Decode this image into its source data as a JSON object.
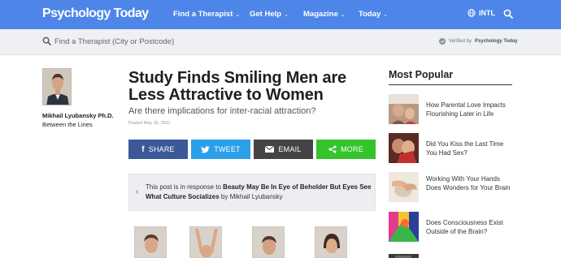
{
  "header": {
    "logo": "Psychology Today",
    "nav": [
      {
        "label": "Find a Therapist"
      },
      {
        "label": "Get Help"
      },
      {
        "label": "Magazine"
      },
      {
        "label": "Today"
      }
    ],
    "intl_label": "INTL",
    "colors": {
      "bar": "#4e85e8",
      "text": "#ffffff"
    }
  },
  "search": {
    "placeholder": "Find a Therapist (City or Postcode)",
    "verified_prefix": "Verified by",
    "verified_brand": "Psychology Today"
  },
  "author": {
    "name": "Mikhail Lyubansky Ph.D.",
    "blog": "Between the Lines"
  },
  "article": {
    "title": "Study Finds Smiling Men are Less Attractive to Women",
    "subtitle": "Are there implications for inter-racial attraction?",
    "posted": "Posted May 30, 2011",
    "share_buttons": [
      {
        "label": "SHARE",
        "icon": "facebook-icon",
        "color": "#3b5998"
      },
      {
        "label": "TWEET",
        "icon": "twitter-icon",
        "color": "#2ba0e8"
      },
      {
        "label": "EMAIL",
        "icon": "email-icon",
        "color": "#444444"
      },
      {
        "label": "MORE",
        "icon": "share-icon",
        "color": "#34c42b"
      }
    ],
    "response": {
      "prefix": "This post is in response to",
      "link_text": "Beauty May Be In Eye of Beholder But Eyes See What Culture Socializes",
      "suffix": "by Mikhail Lyubansky"
    }
  },
  "most_popular": {
    "heading": "Most Popular",
    "items": [
      {
        "title": "How Parental Love Impacts Flourishing Later in Life"
      },
      {
        "title": "Did You Kiss the Last Time You Had Sex?"
      },
      {
        "title": "Working With Your Hands Does Wonders for Your Brain"
      },
      {
        "title": "Does Consciousness Exist Outside of the Brain?"
      }
    ]
  }
}
